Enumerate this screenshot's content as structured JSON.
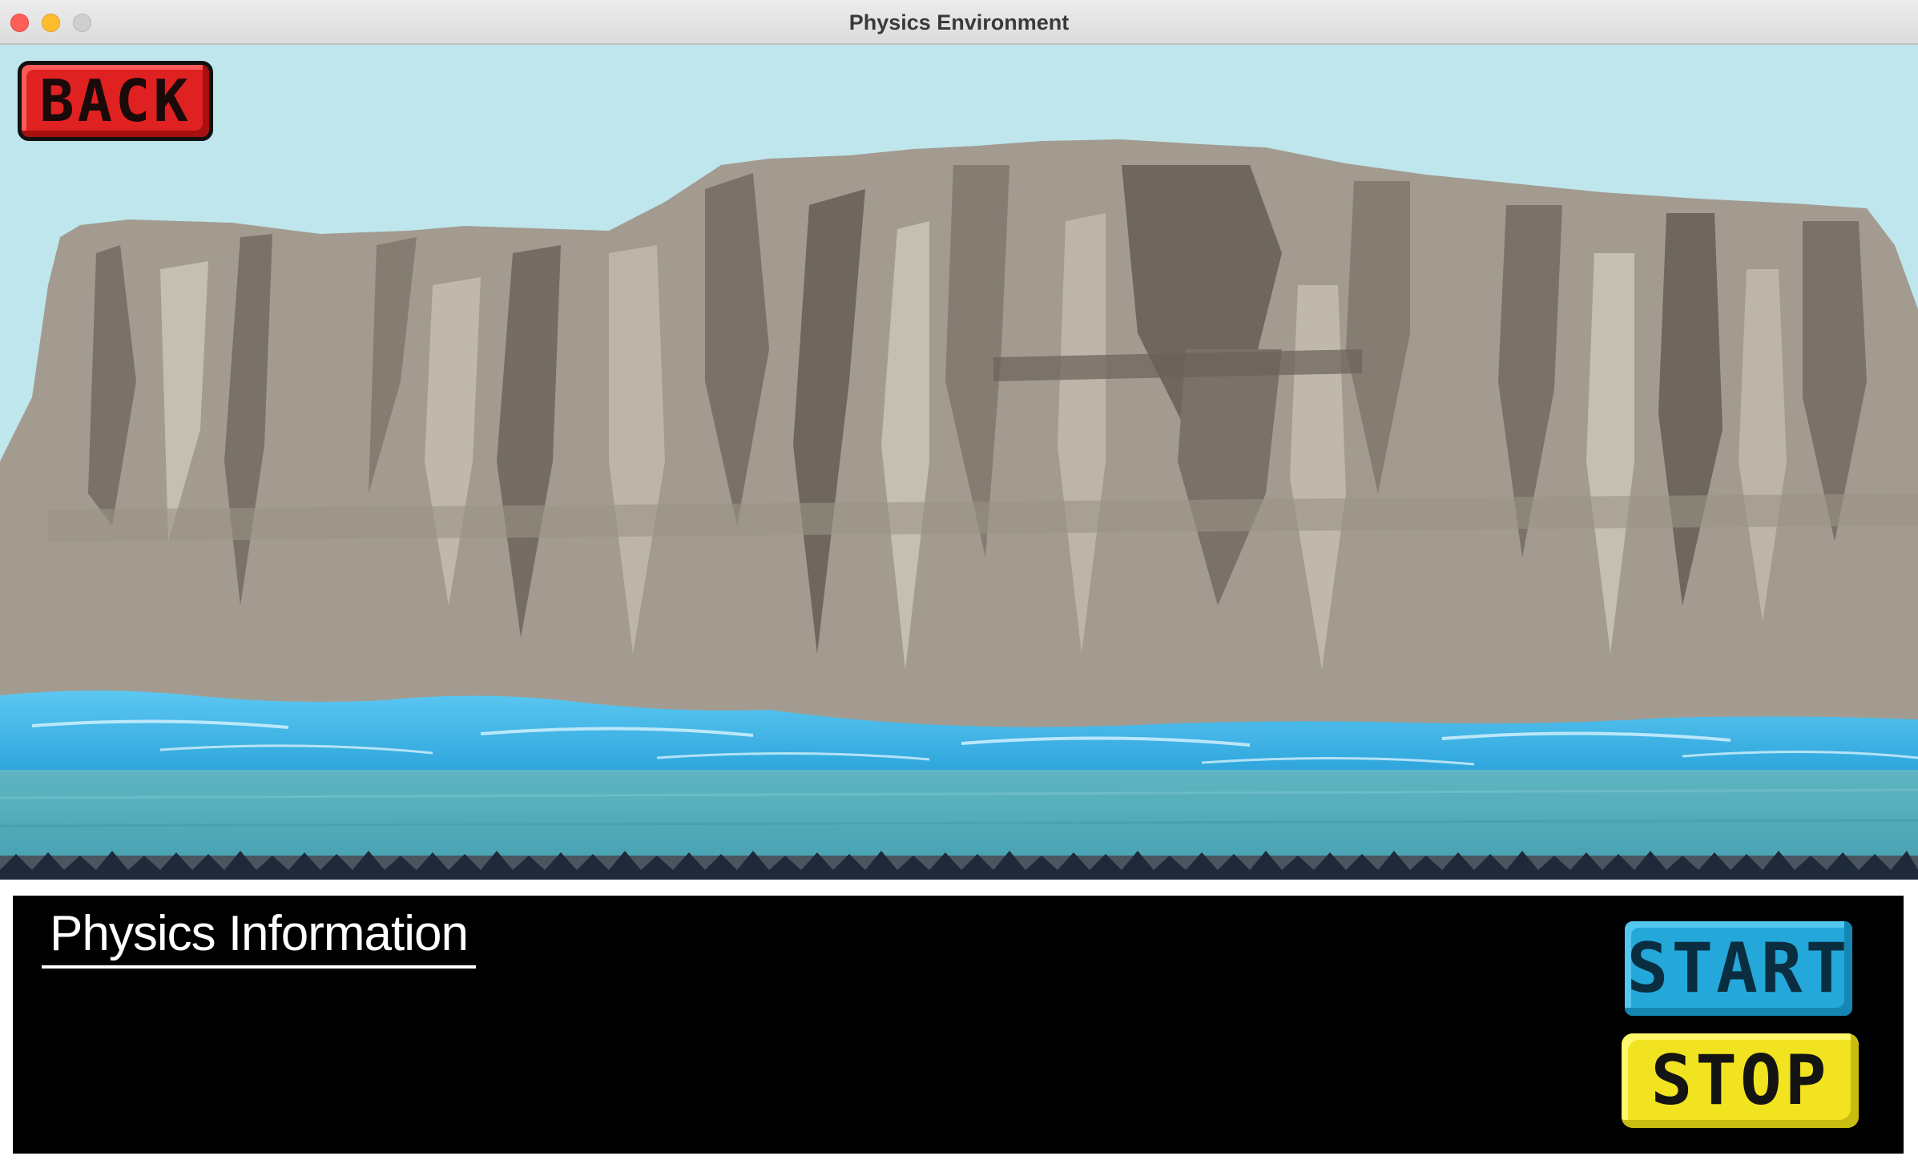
{
  "window": {
    "title": "Physics Environment"
  },
  "scene": {
    "sky_color": "#bfe6ec",
    "cliff_color": "#a39b8f",
    "water_color": "#3fb3e6"
  },
  "buttons": {
    "back_label": "BACK",
    "start_label": "START",
    "stop_label": "STOP"
  },
  "info_panel": {
    "title": "Physics Information",
    "background": "#000000"
  }
}
